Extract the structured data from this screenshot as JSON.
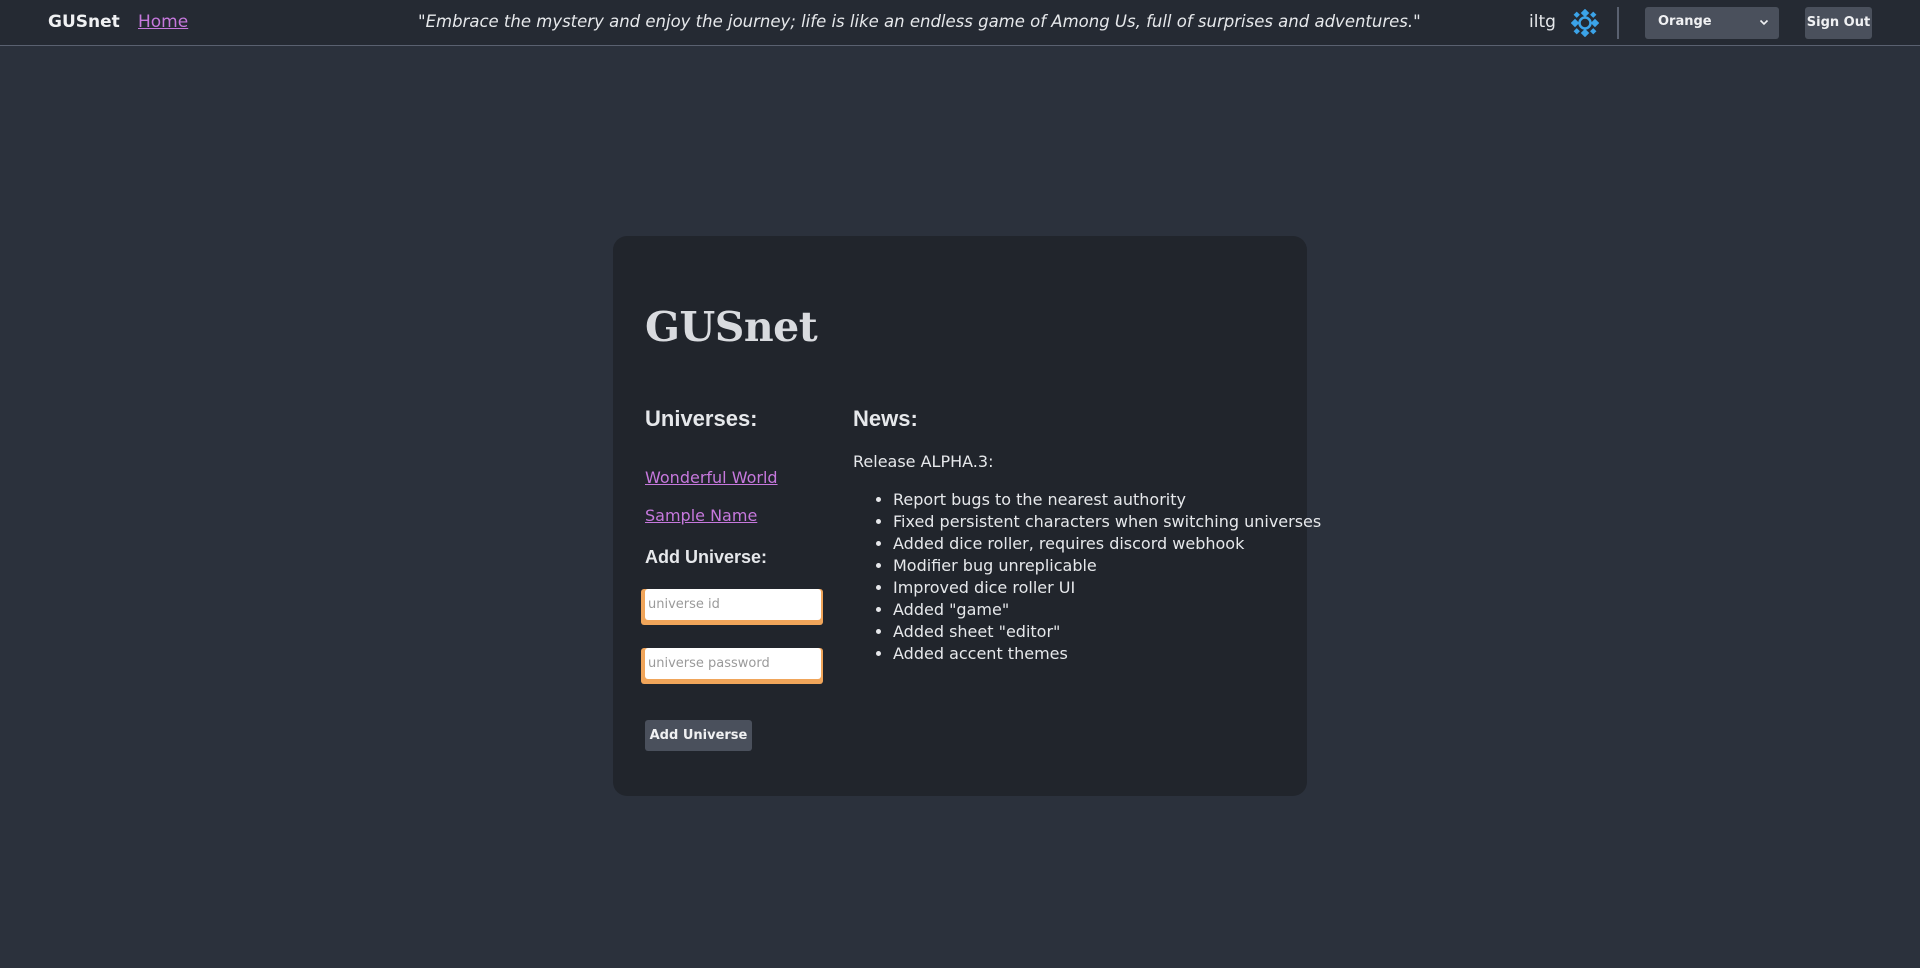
{
  "nav": {
    "brand": "GUSnet",
    "home_link": "Home",
    "quote": "\"Embrace the mystery and enjoy the journey; life is like an endless game of Among Us, full of surprises and adventures.\"",
    "username": "iltg",
    "settings_icon": "settings-gear-icon",
    "theme_select": {
      "value": "Orange"
    },
    "sign_out": "Sign Out"
  },
  "main": {
    "title": "GUSnet",
    "universes": {
      "heading": "Universes:",
      "items": [
        "Wonderful World",
        "Sample Name"
      ]
    },
    "add_universe": {
      "heading": "Add Universe:",
      "id_placeholder": "universe id",
      "password_placeholder": "universe password",
      "button": "Add Universe"
    },
    "news": {
      "heading": "News:",
      "release": "Release ALPHA.3:",
      "items": [
        "Report bugs to the nearest authority",
        "Fixed persistent characters when switching universes",
        "Added dice roller, requires discord webhook",
        "Modifier bug unreplicable",
        "Improved dice roller UI",
        "Added \"game\"",
        "Added sheet \"editor\"",
        "Added accent themes"
      ]
    }
  },
  "colors": {
    "background": "#2b313c",
    "topbar": "#252a33",
    "card": "#21252c",
    "link": "#c678dd",
    "accent": "#f0a55a",
    "button": "#4a505c",
    "icon": "#3ba3e8"
  }
}
